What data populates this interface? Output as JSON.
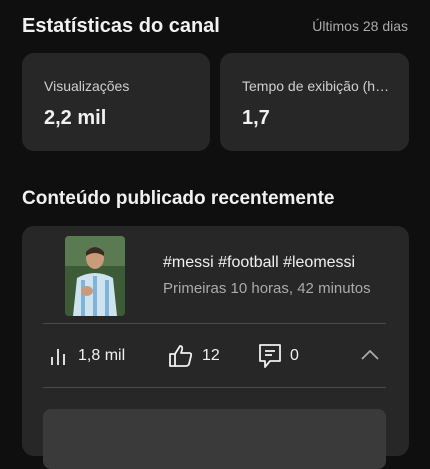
{
  "header": {
    "title": "Estatísticas do canal",
    "period": "Últimos 28 dias"
  },
  "stats": [
    {
      "label": "Visualizações",
      "value": "2,2 mil"
    },
    {
      "label": "Tempo de exibição (horas)",
      "value": "1,7"
    }
  ],
  "recent": {
    "section_title": "Conteúdo publicado recentemente",
    "video": {
      "title": "#messi #football #leomessi",
      "subtitle": "Primeiras 10 horas, 42 minutos",
      "views": "1,8 mil",
      "likes": "12",
      "comments": "0"
    }
  },
  "icons": {
    "views": "bar-chart-icon",
    "likes": "thumbs-up-icon",
    "comments": "comment-icon",
    "expand": "chevron-up-icon"
  },
  "colors": {
    "background": "#0f0f0f",
    "card": "#272727",
    "text_primary": "#f1f1f1",
    "text_secondary": "#aaaaaa"
  }
}
